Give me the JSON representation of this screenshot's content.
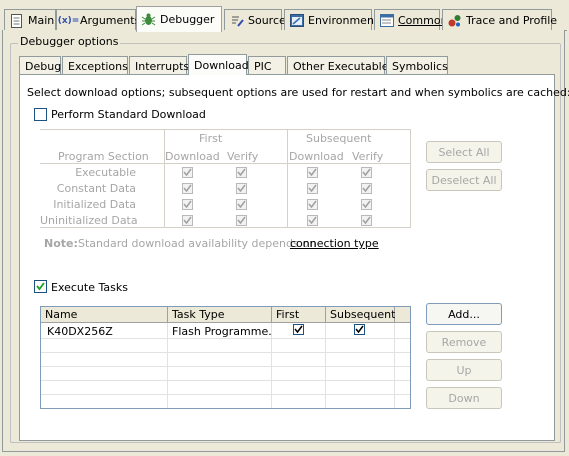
{
  "top_tabs": [
    {
      "label": "Main",
      "icon": "main-page-icon"
    },
    {
      "label": "Arguments",
      "icon": "arguments-icon"
    },
    {
      "label": "Debugger",
      "icon": "debugger-bug-icon"
    },
    {
      "label": "Source",
      "icon": "source-icon"
    },
    {
      "label": "Environment",
      "icon": "environment-icon"
    },
    {
      "label": "Common",
      "icon": "common-icon"
    },
    {
      "label": "Trace and Profile",
      "icon": "trace-profile-icon"
    }
  ],
  "group_title": "Debugger options",
  "inner_tabs": [
    "Debug",
    "Exceptions",
    "Interrupts",
    "Download",
    "PIC",
    "Other Executables",
    "Symbolics"
  ],
  "download": {
    "description": "Select download options; subsequent options are used for restart and when symbolics are cached:",
    "perform_standard_download": {
      "label": "Perform Standard Download",
      "checked": false
    },
    "table": {
      "first_label": "First",
      "subsequent_label": "Subsequent",
      "program_section_label": "Program Section",
      "download_label": "Download",
      "verify_label": "Verify",
      "download2_label": "Download",
      "verify2_label": "Verify",
      "rows": [
        {
          "section": "Executable",
          "first_download": true,
          "first_verify": true,
          "sub_download": true,
          "sub_verify": true
        },
        {
          "section": "Constant Data",
          "first_download": true,
          "first_verify": true,
          "sub_download": true,
          "sub_verify": true
        },
        {
          "section": "Initialized Data",
          "first_download": true,
          "first_verify": true,
          "sub_download": true,
          "sub_verify": true
        },
        {
          "section": "Uninitialized Data",
          "first_download": true,
          "first_verify": true,
          "sub_download": true,
          "sub_verify": true
        }
      ]
    },
    "select_all_label": "Select All",
    "deselect_all_label": "Deselect All",
    "note_label": "Note:",
    "note_text": "Standard download availability depends on",
    "note_link": "connection type"
  },
  "tasks": {
    "execute_tasks": {
      "label": "Execute Tasks",
      "checked": true
    },
    "columns": [
      "Name",
      "Task Type",
      "First",
      "Subsequent"
    ],
    "rows": [
      {
        "name": "K40DX256Z",
        "task_type": "Flash Programme...",
        "first": true,
        "subsequent": true
      }
    ],
    "buttons": {
      "add": "Add...",
      "remove": "Remove",
      "up": "Up",
      "down": "Down"
    }
  }
}
